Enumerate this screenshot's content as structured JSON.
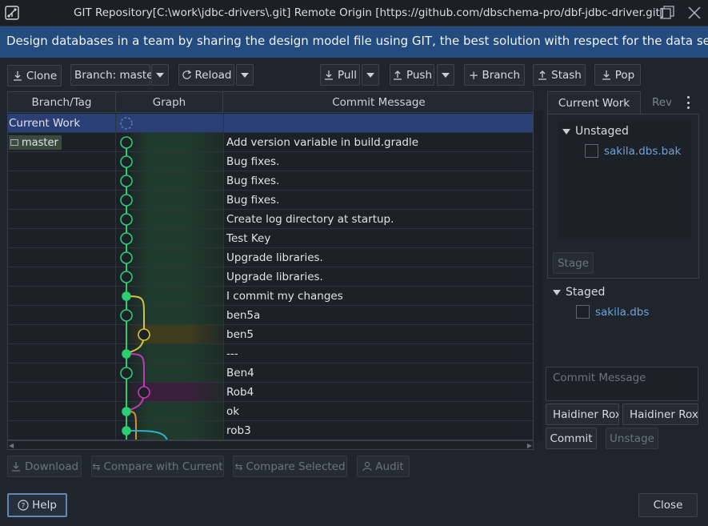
{
  "window": {
    "title": "GIT Repository[C:\\work\\jdbc-drivers\\.git] Remote Origin [https://github.com/dbschema-pro/dbf-jdbc-driver.git]",
    "icons": [
      "git-app-icon",
      "maximize-icon",
      "close-icon"
    ]
  },
  "banner": "Design databases in a team by sharing the design model file using GIT, the best solution with respect for the data secur...",
  "toolbar": {
    "clone": "Clone",
    "branch_select": "Branch: master",
    "reload": "Reload",
    "pull": "Pull",
    "push": "Push",
    "branch": "Branch",
    "stash": "Stash",
    "pop": "Pop"
  },
  "table": {
    "headers": [
      "Branch/Tag",
      "Graph",
      "Commit Message"
    ],
    "rows": [
      {
        "branch": "Current Work",
        "message": ""
      },
      {
        "branch": "master",
        "message": "Add version variable in build.gradle"
      },
      {
        "branch": "",
        "message": "Bug fixes."
      },
      {
        "branch": "",
        "message": "Bug fixes."
      },
      {
        "branch": "",
        "message": "Bug fixes."
      },
      {
        "branch": "",
        "message": "Create log directory at startup."
      },
      {
        "branch": "",
        "message": "Test Key"
      },
      {
        "branch": "",
        "message": "Upgrade libraries."
      },
      {
        "branch": "",
        "message": "Upgrade libraries."
      },
      {
        "branch": "",
        "message": "I commit my changes"
      },
      {
        "branch": "",
        "message": "ben5a"
      },
      {
        "branch": "",
        "message": "ben5"
      },
      {
        "branch": "",
        "message": "---"
      },
      {
        "branch": "",
        "message": "Ben4"
      },
      {
        "branch": "",
        "message": "Rob4"
      },
      {
        "branch": "",
        "message": "ok"
      },
      {
        "branch": "",
        "message": "rob3"
      }
    ]
  },
  "bottom_actions": {
    "download": "Download",
    "compare_current": "Compare with Current",
    "compare_selected": "Compare Selected",
    "audit": "Audit"
  },
  "right_panel": {
    "tabs": [
      "Current Work",
      "Rev"
    ],
    "unstaged_title": "Unstaged",
    "unstaged_files": [
      "sakila.dbs.bak"
    ],
    "stage_button": "Stage",
    "staged_title": "Staged",
    "staged_files": [
      "sakila.dbs"
    ],
    "commit_message_placeholder": "Commit Message",
    "author_name": "Haidiner Roxa",
    "author_email": "Haidiner Roxa",
    "commit_button": "Commit",
    "unstage_button": "Unstage"
  },
  "footer": {
    "help": "Help",
    "close": "Close"
  },
  "colors": {
    "banner": "#234b7d",
    "graph_green": "#2ecc71",
    "graph_yellow": "#d4c43a",
    "graph_magenta": "#c23bb4",
    "graph_orange": "#d4902e",
    "graph_cyan": "#2bb0d0",
    "link": "#6fa3d8"
  }
}
